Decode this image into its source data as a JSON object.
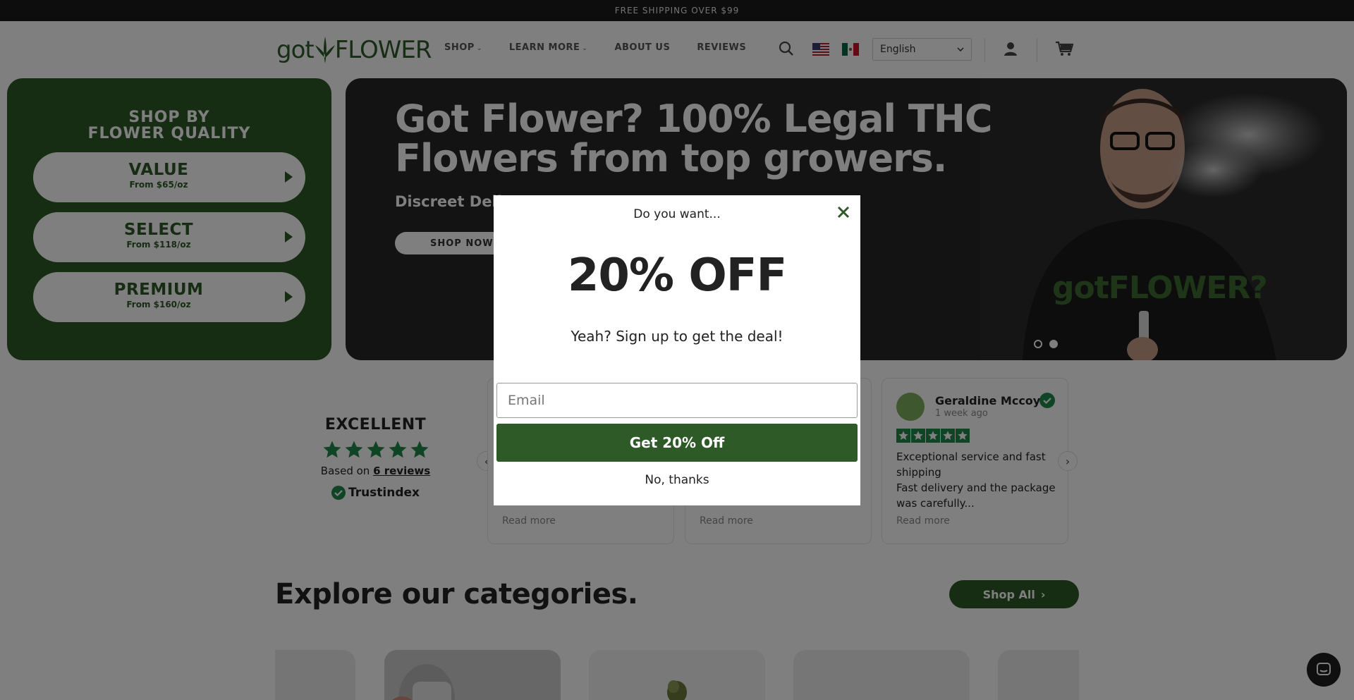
{
  "announcement": {
    "text": "FREE SHIPPING OVER $99"
  },
  "header": {
    "logo_text_left": "got",
    "logo_text_right": "FLOWER",
    "nav": [
      {
        "label": "SHOP",
        "has_dropdown": true
      },
      {
        "label": "LEARN MORE",
        "has_dropdown": true
      },
      {
        "label": "ABOUT US",
        "has_dropdown": false
      },
      {
        "label": "REVIEWS",
        "has_dropdown": false
      }
    ],
    "language": "English",
    "icons": [
      "search-icon",
      "us-flag-icon",
      "mx-flag-icon",
      "account-icon",
      "cart-icon"
    ]
  },
  "quality_panel": {
    "title_line1": "SHOP BY",
    "title_line2": "FLOWER QUALITY",
    "options": [
      {
        "name": "VALUE",
        "price": "From $65/oz"
      },
      {
        "name": "SELECT",
        "price": "From $118/oz"
      },
      {
        "name": "PREMIUM",
        "price": "From $160/oz"
      }
    ]
  },
  "hero": {
    "title": "Got Flower? 100% Legal THC Flowers from top growers.",
    "subtitle": "Discreet Delive",
    "button_label": "SHOP NOW",
    "shirt_text": "gotFLOWER?",
    "active_slide": 2,
    "slide_count": 2
  },
  "trust": {
    "rating_word": "EXCELLENT",
    "stars": 5,
    "based_on_prefix": "Based on ",
    "reviews_link": "6 reviews",
    "brand": "Trustindex"
  },
  "reviews": [
    {
      "name": "",
      "time": "",
      "text": "",
      "read_more": "Read more"
    },
    {
      "name": "",
      "time": "",
      "text": "",
      "read_more": "Read more"
    },
    {
      "name": "Geraldine Mccoy",
      "time": "1 week ago",
      "text_line1": "Exceptional service and fast shipping",
      "text_line2": "Fast delivery and the package was carefully...",
      "read_more": "Read more"
    }
  ],
  "categories": {
    "heading": "Explore our categories.",
    "shop_all": "Shop All"
  },
  "modal": {
    "kicker": "Do you want...",
    "headline": "20% OFF",
    "subtext": "Yeah? Sign up to get the deal!",
    "email_placeholder": "Email",
    "email_value": "",
    "submit_label": "Get 20% Off",
    "decline_label": "No, thanks"
  },
  "colors": {
    "brand_green": "#2d5a27",
    "announcement_bg": "#1b1b1b",
    "star_green": "#1e8a4b",
    "overlay": "rgba(0,0,0,0.5)"
  }
}
